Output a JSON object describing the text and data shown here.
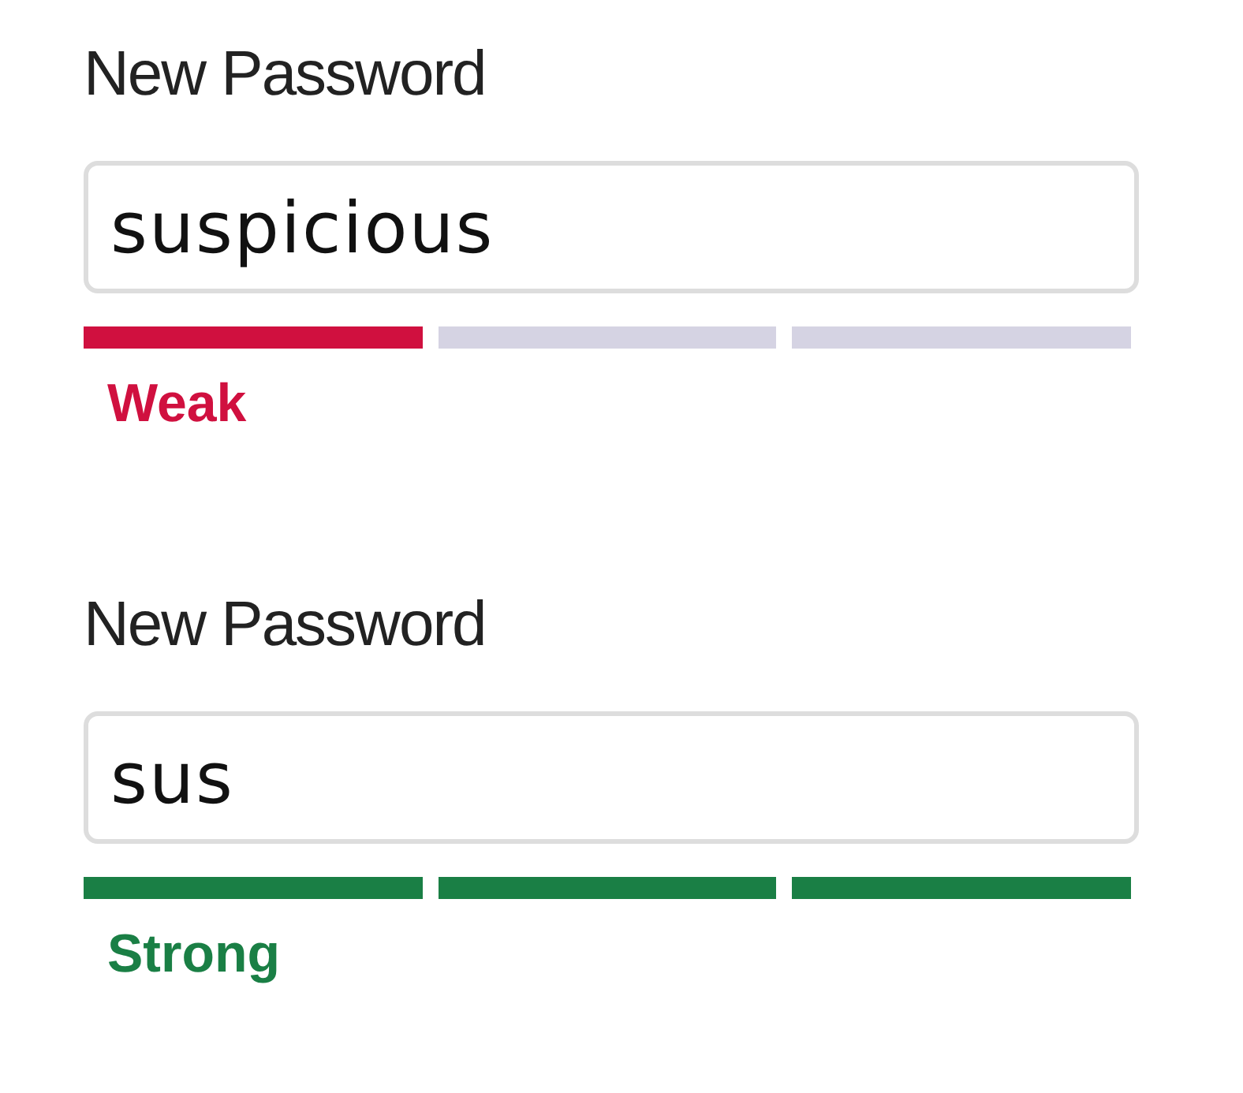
{
  "sections": [
    {
      "label": "New Password",
      "value": "suspicious",
      "meter": {
        "kind": "weak",
        "label": "Weak",
        "segments": [
          {
            "filled": true
          },
          {
            "filled": false
          },
          {
            "filled": false
          }
        ]
      }
    },
    {
      "label": "New Password",
      "value": "sus",
      "meter": {
        "kind": "strong",
        "label": "Strong",
        "segments": [
          {
            "filled": true
          },
          {
            "filled": true
          },
          {
            "filled": true
          }
        ]
      }
    }
  ]
}
